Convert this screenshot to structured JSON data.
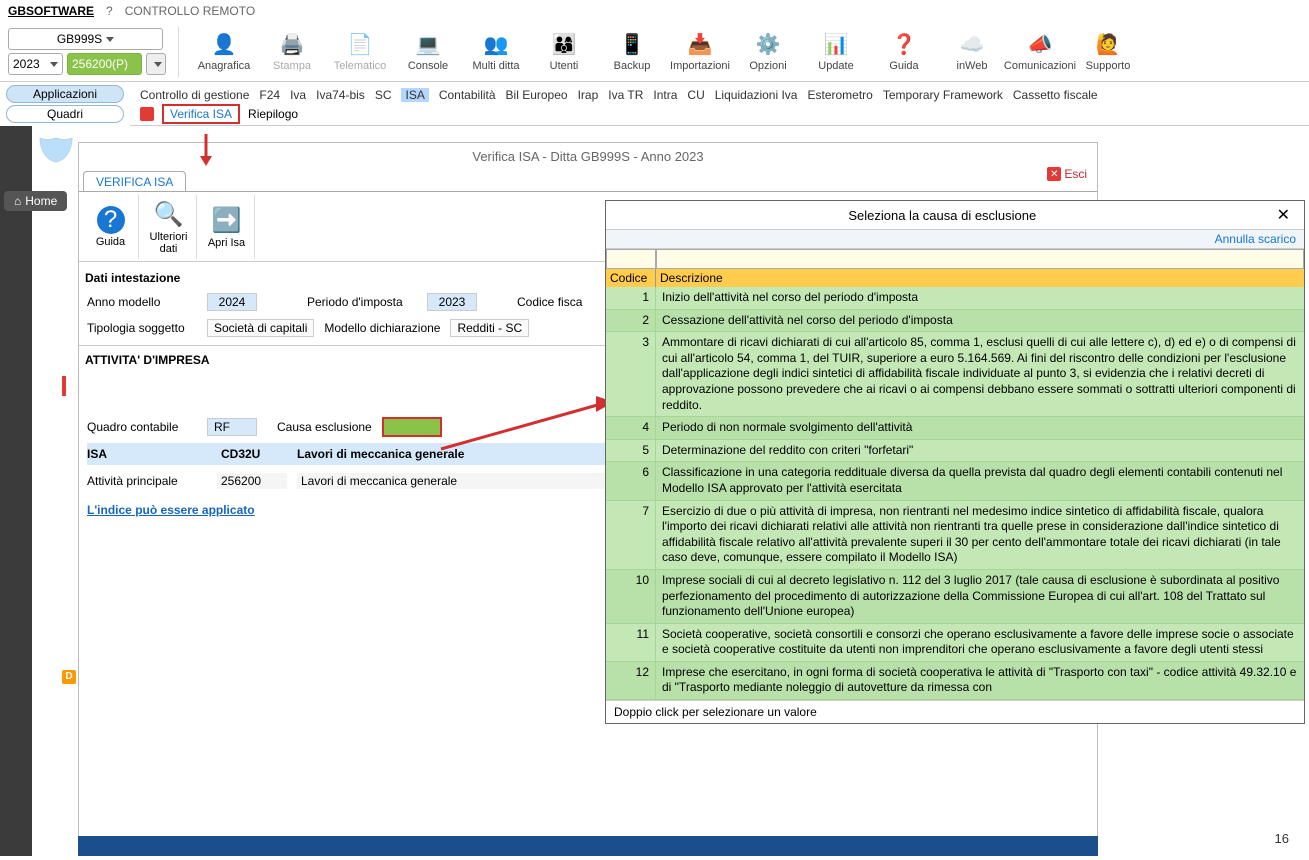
{
  "topMenu": {
    "app": "GBSOFTWARE",
    "help": "?",
    "remote": "CONTROLLO REMOTO"
  },
  "combos": {
    "gb": "GB999S",
    "year": "2023",
    "code": "256200(P)"
  },
  "ribbon": [
    {
      "label": "Anagrafica",
      "icon": "👤",
      "color": "#1976d2"
    },
    {
      "label": "Stampa",
      "icon": "🖨️",
      "disabled": true
    },
    {
      "label": "Telematico",
      "icon": "📄",
      "disabled": true
    },
    {
      "label": "Console",
      "icon": "💻",
      "color": "#1976d2"
    },
    {
      "label": "Multi ditta",
      "icon": "👥",
      "color": "#ff9800"
    },
    {
      "label": "Utenti",
      "icon": "👨‍👩‍👦",
      "color": "#1976d2"
    },
    {
      "label": "Backup",
      "icon": "📱",
      "color": "#1976d2"
    },
    {
      "label": "Importazioni",
      "icon": "📥",
      "color": "#ff9800"
    },
    {
      "label": "Opzioni",
      "icon": "⚙️",
      "color": "#1976d2"
    },
    {
      "label": "Update",
      "icon": "📊",
      "color": "#4caf50"
    },
    {
      "label": "Guida",
      "icon": "❓",
      "color": "#1976d2"
    },
    {
      "label": "inWeb",
      "icon": "☁️",
      "color": "#1976d2"
    },
    {
      "label": "Comunicazioni",
      "icon": "📣",
      "color": "#e91e63"
    },
    {
      "label": "Supporto",
      "icon": "🙋",
      "color": "#1976d2"
    }
  ],
  "sideBtns": {
    "app": "Applicazioni",
    "quadri": "Quadri"
  },
  "tabs": [
    "Controllo di gestione",
    "F24",
    "Iva",
    "Iva74-bis",
    "SC",
    "ISA",
    "Contabilità",
    "Bil Europeo",
    "Irap",
    "Iva TR",
    "Intra",
    "CU",
    "Liquidazioni Iva",
    "Esterometro",
    "Temporary Framework",
    "Cassetto fiscale"
  ],
  "activeTab": "ISA",
  "subtabs": {
    "verifica": "Verifica ISA",
    "riepilogo": "Riepilogo"
  },
  "home": "Home",
  "card": {
    "title": "Verifica ISA - Ditta GB999S - Anno 2023",
    "esci": "Esci",
    "tab": "VERIFICA ISA",
    "tools": [
      {
        "label": "Guida",
        "icon": "?",
        "bg": "#1976d2"
      },
      {
        "label": "Ulteriori dati",
        "icon": "🔍"
      },
      {
        "label": "Apri Isa",
        "icon": "➡️",
        "color": "#4caf50"
      }
    ],
    "sections": {
      "intestazione": "Dati intestazione",
      "annoModello": {
        "label": "Anno modello",
        "value": "2024"
      },
      "periodo": {
        "label": "Periodo d'imposta",
        "value": "2023"
      },
      "codiceFisc": "Codice fisca",
      "tipologia": {
        "label": "Tipologia soggetto",
        "value": "Società di capitali"
      },
      "modelloDich": {
        "label": "Modello dichiarazione",
        "value": "Redditi - SC"
      },
      "attivita": "ATTIVITA' D'IMPRESA",
      "quadro": {
        "label": "Quadro contabile",
        "value": "RF"
      },
      "causa": "Causa esclusione",
      "isa": {
        "label": "ISA",
        "code": "CD32U",
        "desc": "Lavori di meccanica generale"
      },
      "attPrincipale": {
        "label": "Attività principale",
        "code": "256200",
        "desc": "Lavori di meccanica generale"
      },
      "link": "L'indice può essere applicato"
    }
  },
  "modal": {
    "title": "Seleziona la causa di esclusione",
    "annulla": "Annulla scarico",
    "head": {
      "c1": "Codice",
      "c2": "Descrizione"
    },
    "rows": [
      {
        "code": "1",
        "desc": "Inizio dell'attività nel corso del periodo d'imposta"
      },
      {
        "code": "2",
        "desc": "Cessazione dell'attività nel corso del periodo d'imposta"
      },
      {
        "code": "3",
        "desc": "Ammontare di ricavi dichiarati di cui all'articolo 85, comma 1, esclusi quelli di cui alle lettere c), d) ed e) o di compensi di cui all'articolo 54, comma 1, del TUIR, superiore a euro 5.164.569.\nAi fini del riscontro delle condizioni per l'esclusione dall'applicazione degli indici sintetici di affidabilità fiscale individuate al punto 3, si evidenzia che i relativi decreti di approvazione possono prevedere che ai ricavi o ai compensi debbano essere sommati o sottratti ulteriori componenti di reddito."
      },
      {
        "code": "4",
        "desc": "Periodo di non normale svolgimento dell'attività"
      },
      {
        "code": "5",
        "desc": "Determinazione del reddito con criteri \"forfetari\""
      },
      {
        "code": "6",
        "desc": "Classificazione in una categoria reddituale diversa da quella prevista dal quadro degli elementi contabili contenuti nel Modello ISA approvato per l'attività esercitata"
      },
      {
        "code": "7",
        "desc": "Esercizio di due o più attività di impresa, non rientranti nel medesimo indice sintetico di affidabilità fiscale, qualora l'importo dei ricavi dichiarati relativi alle attività non rientranti tra quelle prese in considerazione dall'indice sintetico di affidabilità fiscale relativo all'attività prevalente superi il 30 per cento dell'ammontare totale dei ricavi dichiarati (in tale caso deve, comunque, essere compilato il Modello ISA)"
      },
      {
        "code": "10",
        "desc": "Imprese sociali di cui al decreto legislativo n. 112 del 3 luglio 2017 (tale causa di esclusione è subordinata al positivo perfezionamento del procedimento di autorizzazione della Commissione Europea di cui all'art. 108 del Trattato sul funzionamento dell'Unione europea)"
      },
      {
        "code": "11",
        "desc": "Società cooperative, società consortili e consorzi che operano esclusivamente a favore delle imprese socie o associate e società cooperative costituite da utenti non imprenditori che operano esclusivamente a favore degli utenti stessi"
      },
      {
        "code": "12",
        "desc": "Imprese che esercitano, in ogni forma di società cooperativa le attività di \"Trasporto con taxi\" - codice attività 49.32.10 e di \"Trasporto mediante noleggio di autovetture da rimessa con"
      }
    ],
    "foot": "Doppio click per selezionare un valore"
  },
  "pageNum": "16",
  "orangeTag": "D"
}
